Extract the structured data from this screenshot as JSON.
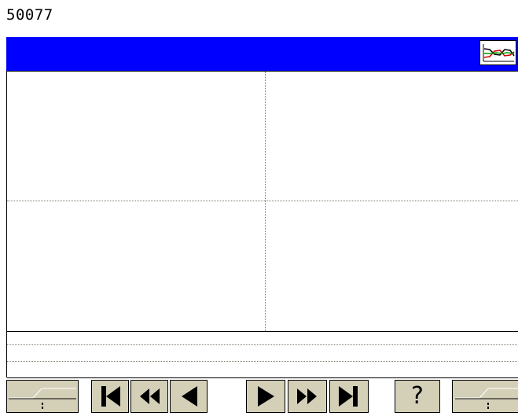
{
  "header": {
    "id_value": "50077"
  },
  "title_bar": {
    "color": "#0000ff"
  },
  "icons": {
    "chart": "line-chart-icon",
    "first": "skip-to-start-icon",
    "rewind": "fast-rewind-icon",
    "back": "step-back-icon",
    "play": "play-icon",
    "forward": "fast-forward-icon",
    "last": "skip-to-end-icon",
    "slider": "slider-icon"
  },
  "toolbar": {
    "help_label": "?"
  },
  "colors": {
    "button_face": "#d4d0b8",
    "grid": "#7a7a6a"
  }
}
